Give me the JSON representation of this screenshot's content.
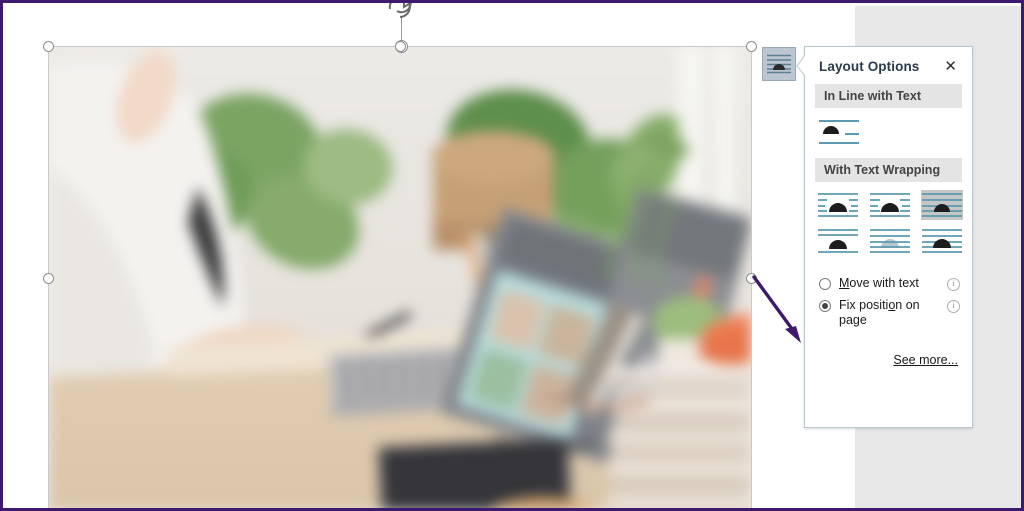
{
  "app": {
    "context": "word-document-image-selected",
    "border_color": "#3d1a6e",
    "page_background": "#ffffff",
    "outside_page_background": "#e8e8e8"
  },
  "canvas": {
    "image_alt": "Blurred photo of a person in a white shirt working at a laptop on a wooden desk with plants, pencil cup, books and an orange object",
    "selection": {
      "handles": [
        "top-left",
        "top-center",
        "top-right",
        "middle-left",
        "middle-right"
      ],
      "rotation_handle": "rotate-handle"
    }
  },
  "launcher": {
    "name": "Layout Options",
    "icon": "layout-options-icon"
  },
  "panel": {
    "title": "Layout Options",
    "close_label": "✕",
    "sections": [
      {
        "id": "in-line",
        "heading": "In Line with Text",
        "options": [
          {
            "id": "in-line-with-text",
            "label": "In Line with Text",
            "selected": false
          }
        ]
      },
      {
        "id": "with-wrapping",
        "heading": "With Text Wrapping",
        "options": [
          {
            "id": "square",
            "label": "Square",
            "selected": false
          },
          {
            "id": "tight",
            "label": "Tight",
            "selected": false
          },
          {
            "id": "through",
            "label": "Through",
            "selected": true
          },
          {
            "id": "top-and-bottom",
            "label": "Top and Bottom",
            "selected": false
          },
          {
            "id": "behind-text",
            "label": "Behind Text",
            "selected": false
          },
          {
            "id": "in-front-of-text",
            "label": "In Front of Text",
            "selected": false
          }
        ]
      }
    ],
    "position_options": [
      {
        "id": "move-with-text",
        "text_before": "",
        "accel": "M",
        "text_after": "ove with text",
        "selected": false,
        "info": "i"
      },
      {
        "id": "fix-position-on-page",
        "text_before": "Fix positi",
        "accel": "o",
        "text_after": "n on page",
        "selected": true,
        "info": "i"
      }
    ],
    "see_more": "See more...",
    "colors": {
      "title": "#2a3b4d",
      "section_header_bg": "#e4e4e4",
      "selected_option_bg": "#c6c6c6",
      "icon_line": "#5b9bb0",
      "icon_shape": "#1d1d1d",
      "border": "#b9c6cc"
    }
  },
  "annotation": {
    "arrow": {
      "color": "#3d1a6e",
      "points_to": "fix-position-on-page"
    }
  }
}
